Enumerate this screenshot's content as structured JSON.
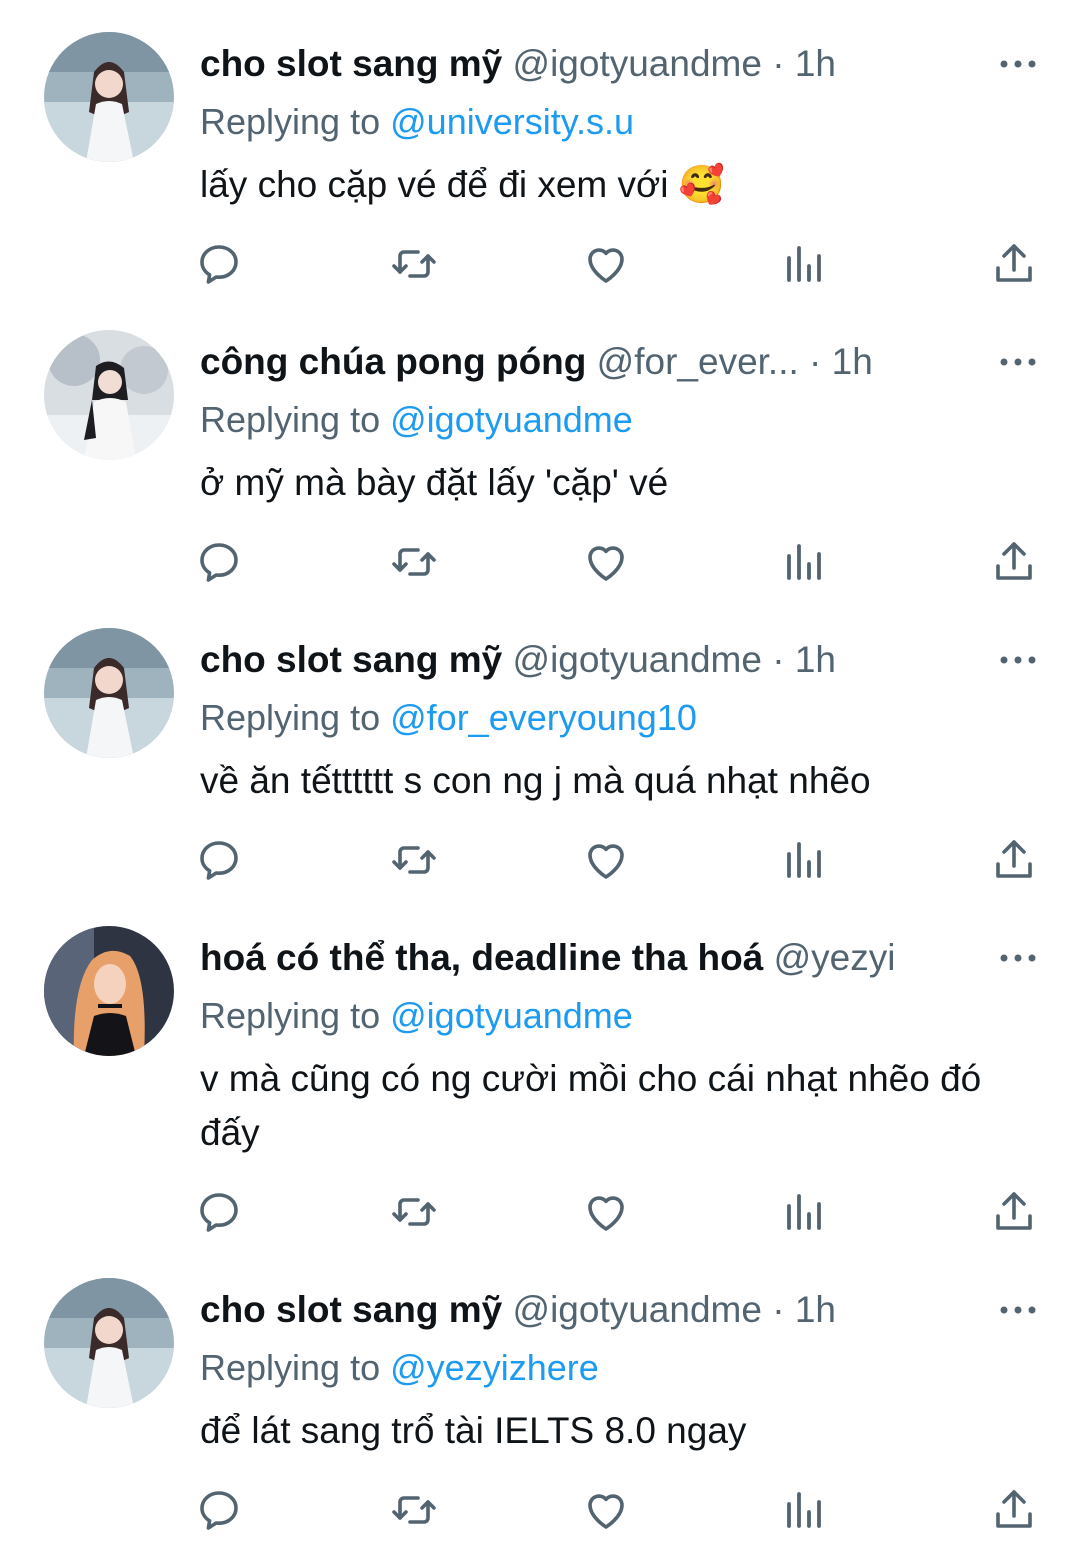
{
  "colors": {
    "text": "#0f1419",
    "muted": "#536471",
    "link": "#1d9bf0",
    "icon": "#536471"
  },
  "reply_prefix": "Replying to",
  "icons": [
    "reply-icon",
    "retweet-icon",
    "like-icon",
    "views-icon",
    "share-icon",
    "more-icon"
  ],
  "tweets": [
    {
      "name": "cho slot sang mỹ",
      "handle": "@igotyuandme",
      "dot": "·",
      "time": "1h",
      "replying_to": "@university.s.u",
      "text": "lấy cho cặp vé để đi xem với 🥰"
    },
    {
      "name": "công chúa pong póng",
      "handle": "@for_ever...",
      "dot": "·",
      "time": "1h",
      "replying_to": "@igotyuandme",
      "text": "ở mỹ mà bày đặt lấy 'cặp' vé"
    },
    {
      "name": "cho slot sang mỹ",
      "handle": "@igotyuandme",
      "dot": "·",
      "time": "1h",
      "replying_to": "@for_everyoung10",
      "text": "về ăn tếtttttt s con ng j mà quá nhạt nhẽo"
    },
    {
      "name": "hoá có thể tha, deadline tha hoá",
      "handle": "@yezyi",
      "dot": "",
      "time": "",
      "replying_to": "@igotyuandme",
      "text": "v mà cũng có ng cười mồi cho cái nhạt nhẽo đó đấy"
    },
    {
      "name": "cho slot sang mỹ",
      "handle": "@igotyuandme",
      "dot": "·",
      "time": "1h",
      "replying_to": "@yezyizhere",
      "text": "để lát sang trổ tài IELTS 8.0 ngay"
    }
  ]
}
